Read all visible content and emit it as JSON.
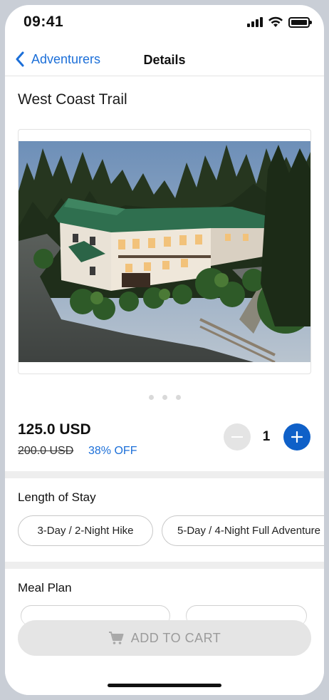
{
  "status_bar": {
    "time": "09:41",
    "icons": [
      "signal-icon",
      "wifi-icon",
      "battery-icon"
    ]
  },
  "nav": {
    "back_label": "Adventurers",
    "title": "Details",
    "back_icon": "chevron-left-icon"
  },
  "product": {
    "title": "West Coast Trail",
    "image": "lodge-photo",
    "pager_dots": 3,
    "price": "125.0 USD",
    "original_price": "200.0 USD",
    "discount": "38% OFF",
    "quantity": "1"
  },
  "length_of_stay": {
    "label": "Length of Stay",
    "options": [
      "3-Day / 2-Night Hike",
      "5-Day / 4-Night Full Adventure"
    ]
  },
  "meal_plan": {
    "label": "Meal Plan"
  },
  "cart": {
    "label": "ADD TO CART",
    "icon": "cart-icon"
  },
  "colors": {
    "accent": "#1c6fd8",
    "primary_button": "#0f60c8",
    "disabled_button": "#e5e5e5"
  }
}
